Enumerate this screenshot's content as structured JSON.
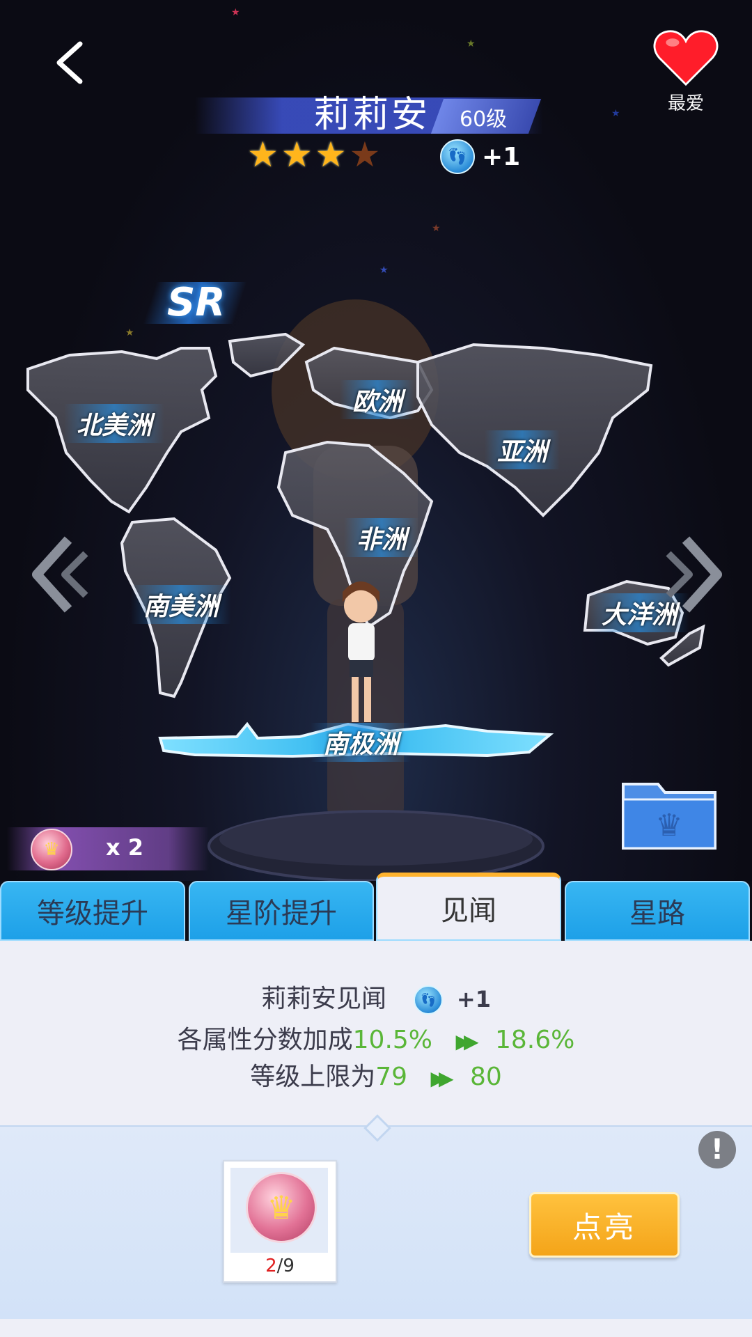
{
  "header": {
    "back_icon": "chevron-left-icon",
    "character_name": "莉莉安",
    "level": "60级",
    "star_rating": 3,
    "star_max": 4,
    "bonus": "+1",
    "favorite_label": "最爱",
    "favorite_icon": "heart-icon"
  },
  "card": {
    "rarity": "SR"
  },
  "map": {
    "continents": [
      "北美洲",
      "欧洲",
      "亚洲",
      "非洲",
      "南美洲",
      "大洋洲",
      "南极洲"
    ]
  },
  "inventory": {
    "medal_count": "x 2"
  },
  "tabs": [
    "等级提升",
    "星阶提升",
    "见闻",
    "星路"
  ],
  "active_tab": "见闻",
  "info": {
    "title": "莉莉安见闻",
    "bonus": "+1",
    "attr_label": "各属性分数加成",
    "attr_from": "10.5%",
    "attr_to": "18.6%",
    "level_label": "等级上限为",
    "level_from": "79",
    "level_to": "80"
  },
  "requirement": {
    "have": "2",
    "need": "/9",
    "button_label": "点亮"
  },
  "colors": {
    "tab_blue": "#1da0e8",
    "active_accent": "#ffb32e",
    "value_green": "#5ab638",
    "button_orange": "#f4a419"
  }
}
